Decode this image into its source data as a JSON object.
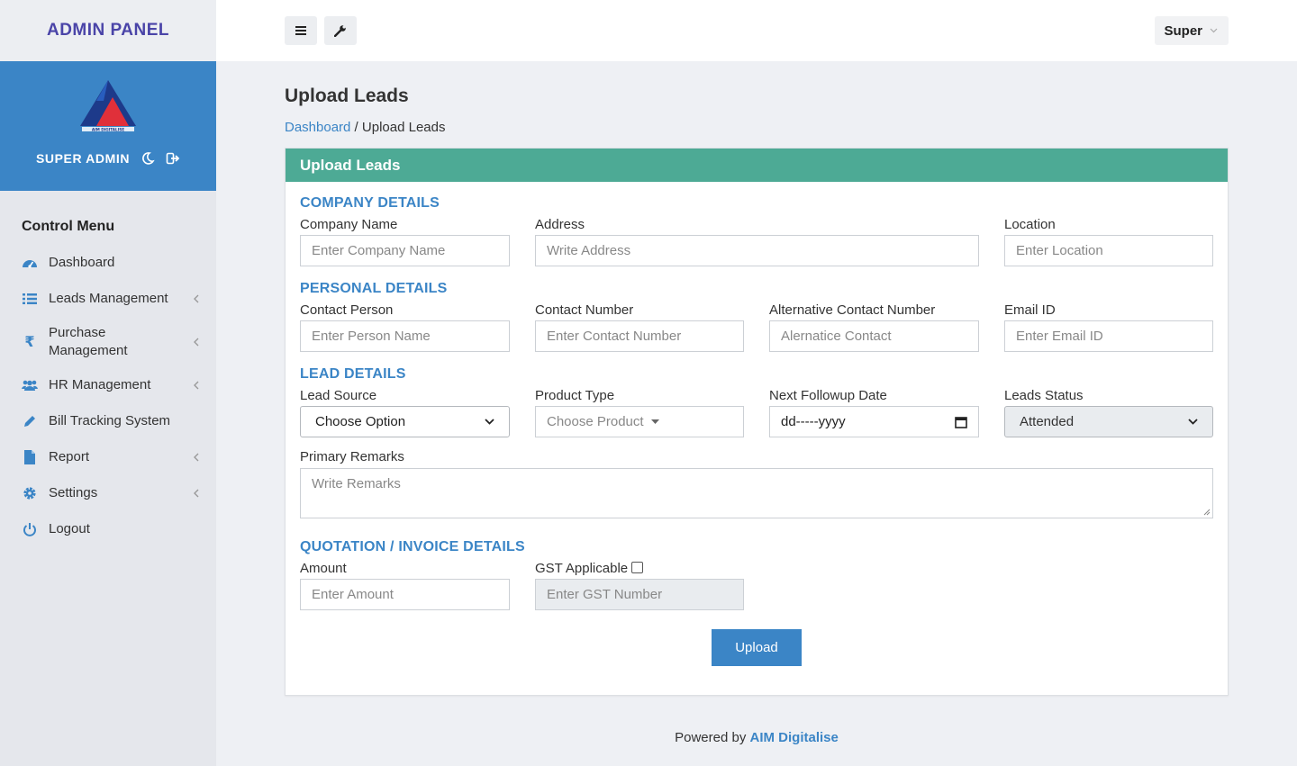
{
  "brand": {
    "title": "ADMIN PANEL",
    "logo_text": "AIM DIGITALISE"
  },
  "user": {
    "name": "SUPER ADMIN"
  },
  "sidebar": {
    "title": "Control Menu",
    "items": [
      {
        "label": "Dashboard",
        "icon": "dashboard-icon"
      },
      {
        "label": "Leads Management",
        "icon": "list-icon"
      },
      {
        "label": "Purchase Management",
        "icon": "rupee-icon"
      },
      {
        "label": "HR Management",
        "icon": "users-icon"
      },
      {
        "label": "Bill Tracking System",
        "icon": "pencil-icon"
      },
      {
        "label": "Report",
        "icon": "file-icon"
      },
      {
        "label": "Settings",
        "icon": "gear-icon"
      },
      {
        "label": "Logout",
        "icon": "power-icon"
      }
    ]
  },
  "topbar": {
    "user_label": "Super"
  },
  "page": {
    "title": "Upload Leads",
    "breadcrumb_home": "Dashboard",
    "breadcrumb_sep": " / ",
    "breadcrumb_current": "Upload Leads"
  },
  "form": {
    "header": "Upload Leads",
    "company": {
      "section": "COMPANY DETAILS",
      "company_name_label": "Company Name",
      "company_name_ph": "Enter Company Name",
      "address_label": "Address",
      "address_ph": "Write Address",
      "location_label": "Location",
      "location_ph": "Enter Location"
    },
    "personal": {
      "section": "PERSONAL DETAILS",
      "contact_person_label": "Contact Person",
      "contact_person_ph": "Enter Person Name",
      "contact_number_label": "Contact Number",
      "contact_number_ph": "Enter Contact Number",
      "alt_contact_label": "Alternative Contact Number",
      "alt_contact_ph": "Alernatice Contact",
      "email_label": "Email ID",
      "email_ph": "Enter Email ID"
    },
    "lead": {
      "section": "LEAD DETAILS",
      "lead_source_label": "Lead Source",
      "lead_source_value": "Choose Option",
      "product_type_label": "Product Type",
      "product_type_value": "Choose Product",
      "followup_label": "Next Followup Date",
      "followup_value": "dd-----yyyy",
      "status_label": "Leads Status",
      "status_value": "Attended",
      "remarks_label": "Primary Remarks",
      "remarks_ph": "Write Remarks"
    },
    "quotation": {
      "section": "QUOTATION / INVOICE DETAILS",
      "amount_label": "Amount",
      "amount_ph": "Enter Amount",
      "gst_label": "GST Applicable",
      "gst_checked": false,
      "gst_ph": "Enter GST Number"
    },
    "submit_label": "Upload"
  },
  "footer": {
    "prefix": "Powered by ",
    "link": "AIM Digitalise"
  },
  "colors": {
    "primary": "#3b85c6",
    "header_green": "#4daa95",
    "brand_purple": "#4a44a8"
  }
}
